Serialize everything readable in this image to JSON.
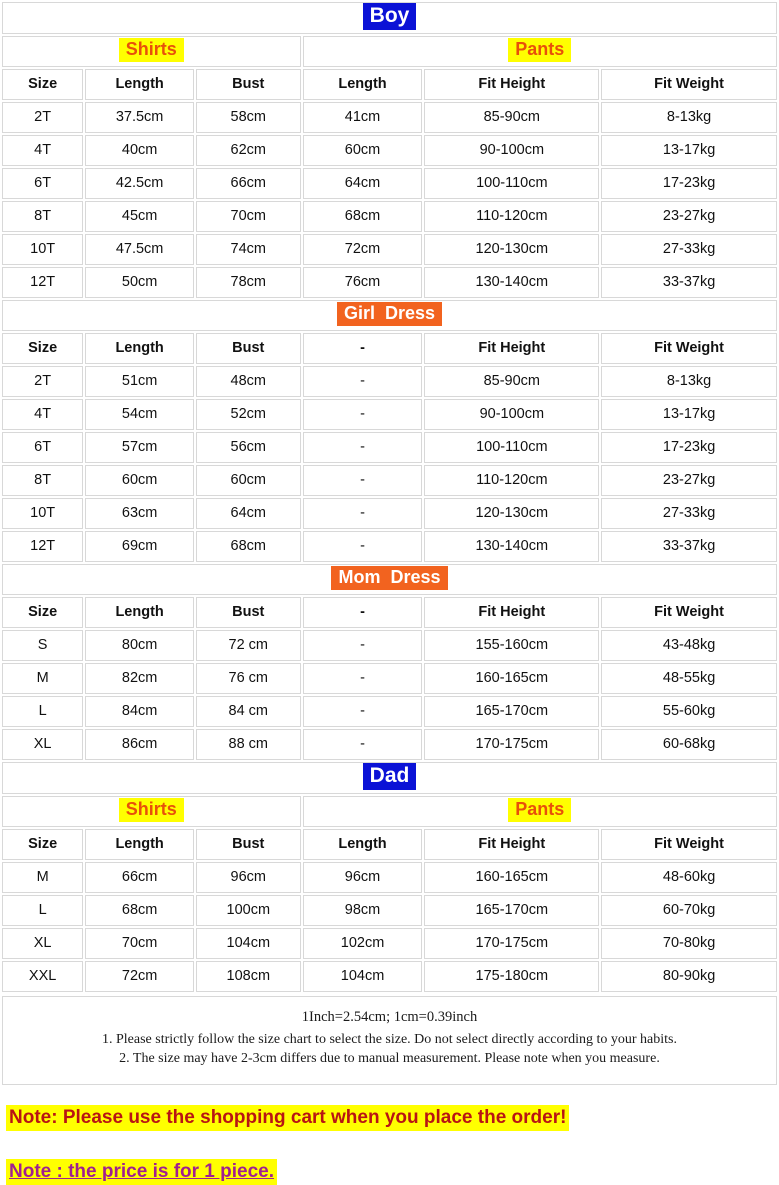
{
  "columns": [
    "Size",
    "Length",
    "Bust",
    "Length",
    "Fit Height",
    "Fit Weight"
  ],
  "colors": {
    "badge_blue_bg": "#0b12d6",
    "badge_blue_text": "#ffffff",
    "badge_orange_bg": "#f2631f",
    "badge_orange_text": "#ffffff",
    "badge_yellow_bg": "#ffff00",
    "badge_yellow_text": "#e8500a",
    "note_red": "#b81414",
    "note_purple": "#a02090",
    "note_highlight": "#ffff00",
    "border": "#d8d8d8"
  },
  "sections": [
    {
      "title": "Boy",
      "title_style": "blue",
      "groups": [
        {
          "label": "Shirts",
          "style": "yellow",
          "span": 3
        },
        {
          "label": "Pants",
          "style": "yellow",
          "span": 3
        }
      ],
      "headers": [
        "Size",
        "Length",
        "Bust",
        "Length",
        "Fit Height",
        "Fit Weight"
      ],
      "rows": [
        [
          "2T",
          "37.5cm",
          "58cm",
          "41cm",
          "85-90cm",
          "8-13kg"
        ],
        [
          "4T",
          "40cm",
          "62cm",
          "60cm",
          "90-100cm",
          "13-17kg"
        ],
        [
          "6T",
          "42.5cm",
          "66cm",
          "64cm",
          "100-110cm",
          "17-23kg"
        ],
        [
          "8T",
          "45cm",
          "70cm",
          "68cm",
          "110-120cm",
          "23-27kg"
        ],
        [
          "10T",
          "47.5cm",
          "74cm",
          "72cm",
          "120-130cm",
          "27-33kg"
        ],
        [
          "12T",
          "50cm",
          "78cm",
          "76cm",
          "130-140cm",
          "33-37kg"
        ]
      ]
    },
    {
      "title": "Girl  Dress",
      "title_style": "orange",
      "groups": [],
      "headers": [
        "Size",
        "Length",
        "Bust",
        "-",
        "Fit Height",
        "Fit Weight"
      ],
      "rows": [
        [
          "2T",
          "51cm",
          "48cm",
          "-",
          "85-90cm",
          "8-13kg"
        ],
        [
          "4T",
          "54cm",
          "52cm",
          "-",
          "90-100cm",
          "13-17kg"
        ],
        [
          "6T",
          "57cm",
          "56cm",
          "-",
          "100-110cm",
          "17-23kg"
        ],
        [
          "8T",
          "60cm",
          "60cm",
          "-",
          "110-120cm",
          "23-27kg"
        ],
        [
          "10T",
          "63cm",
          "64cm",
          "-",
          "120-130cm",
          "27-33kg"
        ],
        [
          "12T",
          "69cm",
          "68cm",
          "-",
          "130-140cm",
          "33-37kg"
        ]
      ]
    },
    {
      "title": "Mom  Dress",
      "title_style": "orange",
      "groups": [],
      "headers": [
        "Size",
        "Length",
        "Bust",
        "-",
        "Fit Height",
        "Fit Weight"
      ],
      "rows": [
        [
          "S",
          "80cm",
          "72 cm",
          "-",
          "155-160cm",
          "43-48kg"
        ],
        [
          "M",
          "82cm",
          "76 cm",
          "-",
          "160-165cm",
          "48-55kg"
        ],
        [
          "L",
          "84cm",
          "84 cm",
          "-",
          "165-170cm",
          "55-60kg"
        ],
        [
          "XL",
          "86cm",
          "88 cm",
          "-",
          "170-175cm",
          "60-68kg"
        ]
      ]
    },
    {
      "title": "Dad",
      "title_style": "blue",
      "groups": [
        {
          "label": "Shirts",
          "style": "yellow",
          "span": 3
        },
        {
          "label": "Pants",
          "style": "yellow",
          "span": 3
        }
      ],
      "headers": [
        "Size",
        "Length",
        "Bust",
        "Length",
        "Fit Height",
        "Fit Weight"
      ],
      "rows": [
        [
          "M",
          "66cm",
          "96cm",
          "96cm",
          "160-165cm",
          "48-60kg"
        ],
        [
          "L",
          "68cm",
          "100cm",
          "98cm",
          "165-170cm",
          "60-70kg"
        ],
        [
          "XL",
          "70cm",
          "104cm",
          "102cm",
          "170-175cm",
          "70-80kg"
        ],
        [
          "XXL",
          "72cm",
          "108cm",
          "104cm",
          "175-180cm",
          "80-90kg"
        ]
      ]
    }
  ],
  "notes": {
    "conversion": "1Inch=2.54cm; 1cm=0.39inch",
    "line1": "1. Please strictly follow the size chart to select the size. Do not select directly according to your habits.",
    "line2": "2. The size may have 2-3cm differs due to manual measurement. Please note when you measure."
  },
  "bottom_notes": {
    "note1": "Note: Please use the shopping cart when you place the order!",
    "note2": "Note : the price is for 1 piece."
  }
}
